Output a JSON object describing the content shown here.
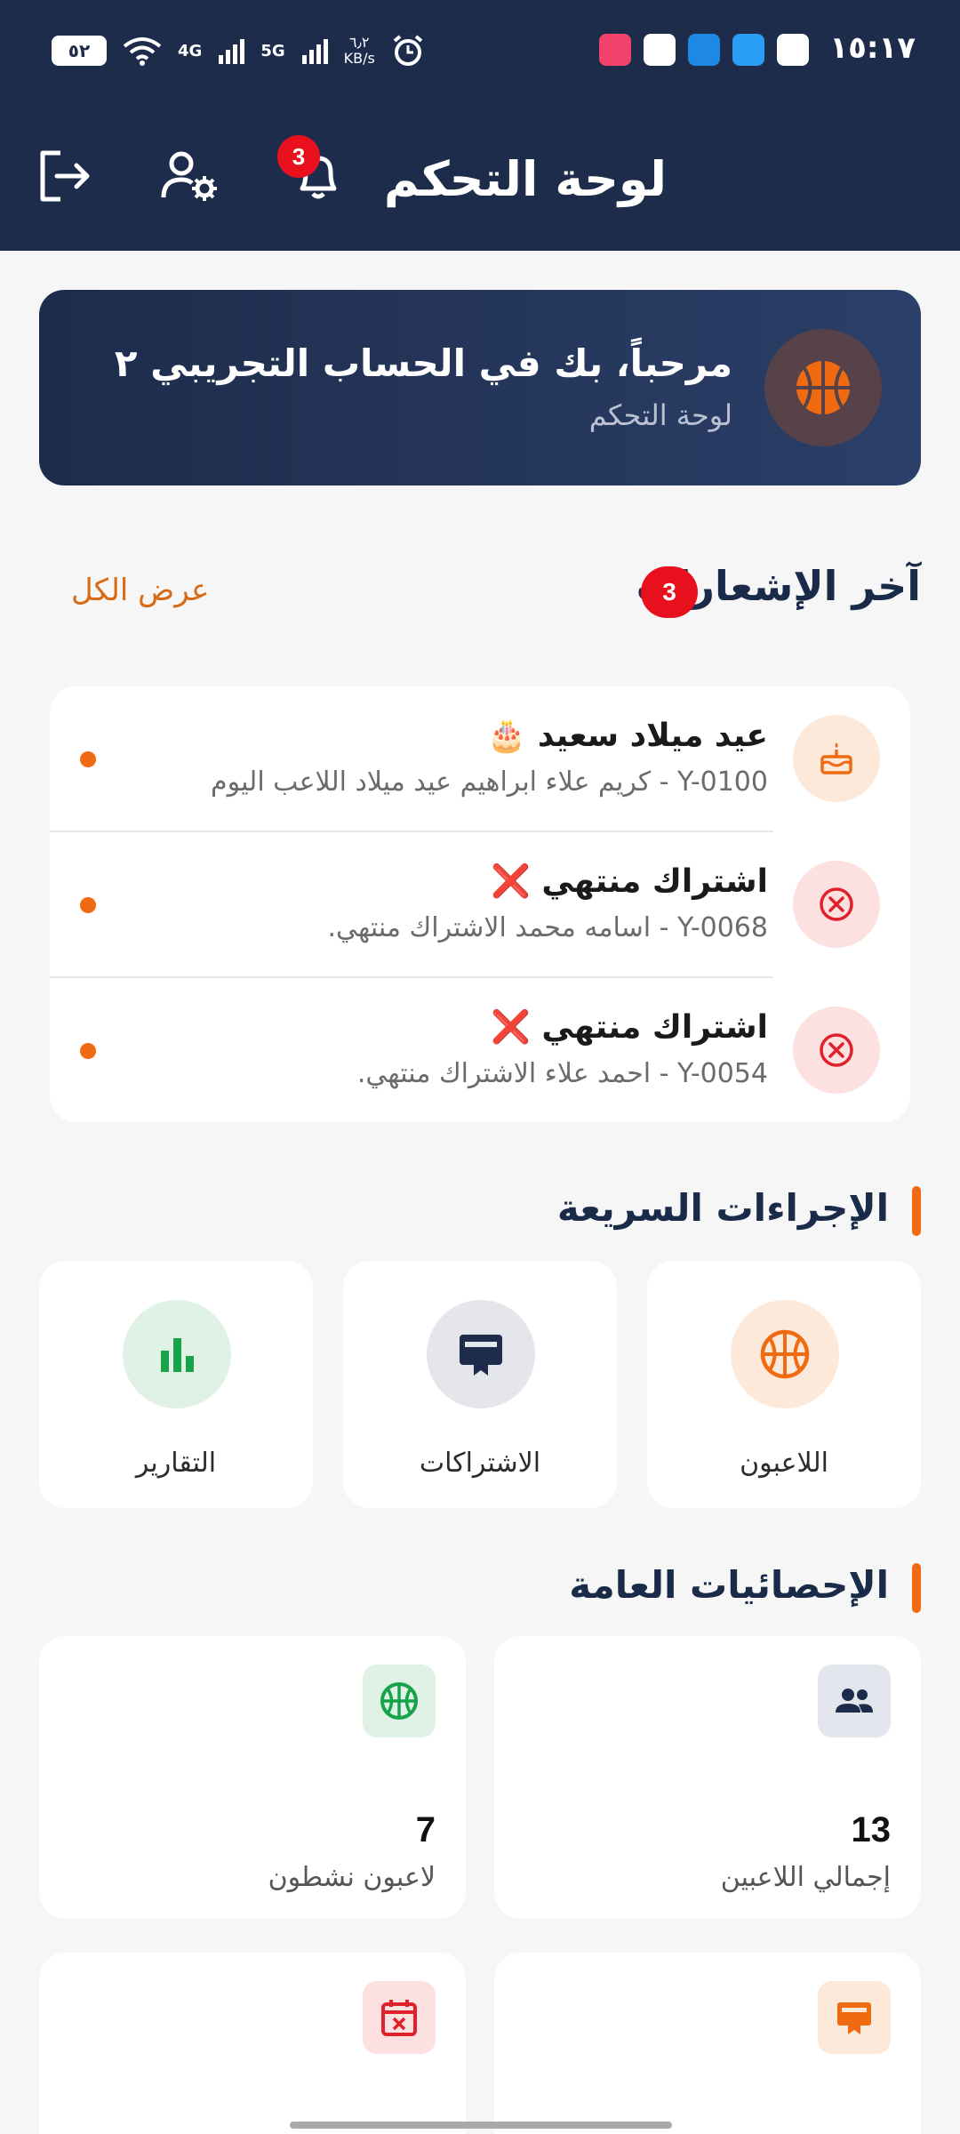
{
  "status_bar": {
    "time": "١٥:١٧",
    "battery": "٥٢",
    "network_1": "4G",
    "network_2": "5G",
    "speed_value": "٦٫٢",
    "speed_unit": "KB/s"
  },
  "header": {
    "title": "لوحة التحكم",
    "notification_badge": "3"
  },
  "welcome": {
    "title": "مرحباً، بك في الحساب التجريبي ٢",
    "subtitle": "لوحة التحكم"
  },
  "notifications_section": {
    "title": "آخر الإشعارات",
    "count": "3",
    "view_all": "عرض الكل",
    "items": [
      {
        "title": "عيد ميلاد سعيد 🎂",
        "desc": "Y-0100 - كريم علاء ابراهيم عيد ميلاد اللاعب اليوم",
        "icon": "cake-icon"
      },
      {
        "title": "اشتراك منتهي ❌",
        "desc": "Y-0068 - اسامه محمد الاشتراك منتهي.",
        "icon": "x-circle-icon"
      },
      {
        "title": "اشتراك منتهي ❌",
        "desc": "Y-0054 - احمد علاء الاشتراك منتهي.",
        "icon": "x-circle-icon"
      }
    ]
  },
  "quick_actions": {
    "title": "الإجراءات السريعة",
    "items": [
      {
        "label": "اللاعبون",
        "icon": "basketball-icon"
      },
      {
        "label": "الاشتراكات",
        "icon": "card-icon"
      },
      {
        "label": "التقارير",
        "icon": "bar-chart-icon"
      }
    ]
  },
  "stats": {
    "title": "الإحصائيات العامة",
    "items": [
      {
        "value": "13",
        "label": "إجمالي اللاعبين",
        "icon": "people-icon"
      },
      {
        "value": "7",
        "label": "لاعبون نشطون",
        "icon": "basketball-icon"
      },
      {
        "value": "",
        "label": "",
        "icon": "card-icon"
      },
      {
        "value": "",
        "label": "",
        "icon": "calendar-x-icon"
      }
    ]
  },
  "colors": {
    "header_bg": "#1d2c4b",
    "accent": "#f06a12",
    "badge": "#e8101c"
  }
}
